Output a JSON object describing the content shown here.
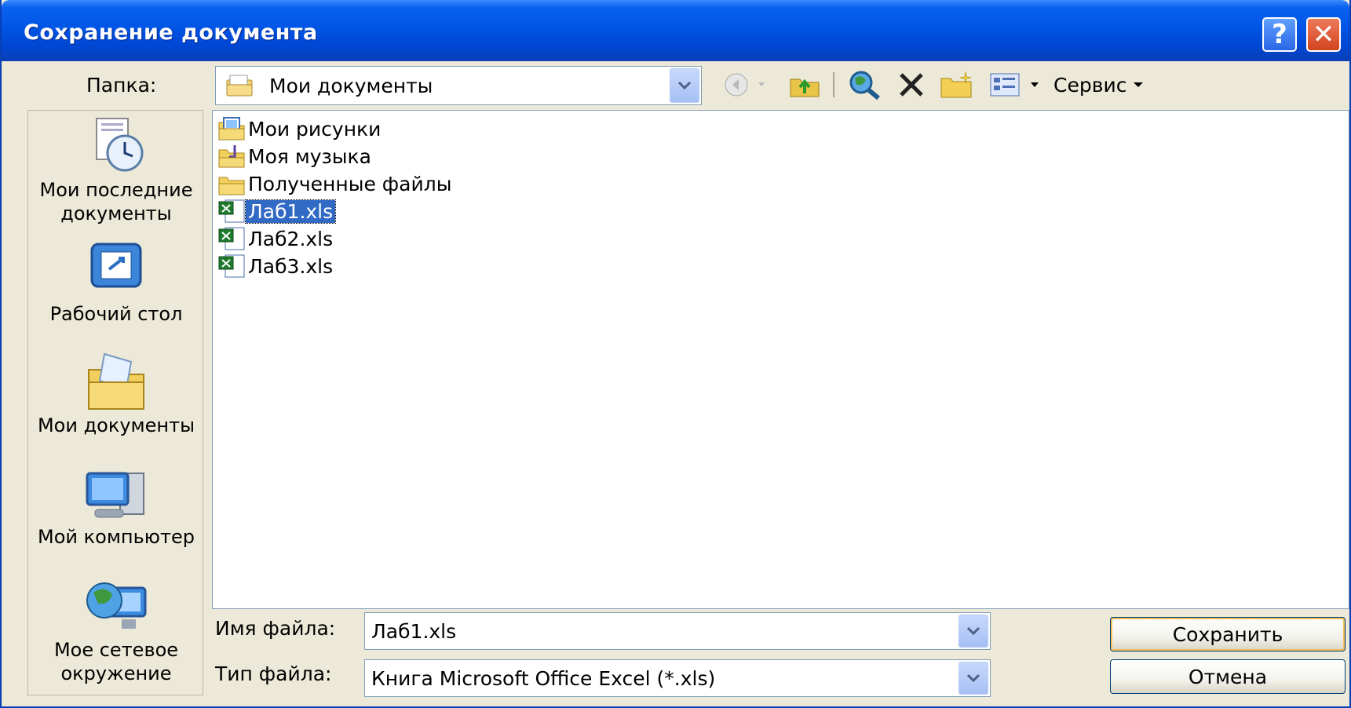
{
  "dialog": {
    "title": "Сохранение документа",
    "help_label": "?",
    "close_label": "✕"
  },
  "toolbar": {
    "folder_label": "Папка:",
    "folder_value": "Мои документы",
    "tools_label": "Сервис"
  },
  "places": [
    {
      "icon": "recent-documents-icon",
      "label": "Мои последние документы"
    },
    {
      "icon": "desktop-icon",
      "label": "Рабочий стол"
    },
    {
      "icon": "my-documents-icon",
      "label": "Мои документы"
    },
    {
      "icon": "my-computer-icon",
      "label": "Мой компьютер"
    },
    {
      "icon": "network-places-icon",
      "label": "Мое сетевое окружение"
    }
  ],
  "files": [
    {
      "type": "folder-pictures",
      "name": "Мои рисунки",
      "selected": false
    },
    {
      "type": "folder-music",
      "name": "Моя музыка",
      "selected": false
    },
    {
      "type": "folder",
      "name": "Полученные файлы",
      "selected": false
    },
    {
      "type": "xls",
      "name": "Лаб1.xls",
      "selected": true
    },
    {
      "type": "xls",
      "name": "Лаб2.xls",
      "selected": false
    },
    {
      "type": "xls",
      "name": "Лаб3.xls",
      "selected": false
    }
  ],
  "form": {
    "filename_label": "Имя файла:",
    "filename_value": "Лаб1.xls",
    "filetype_label": "Тип файла:",
    "filetype_value": "Книга Microsoft Office Excel (*.xls)"
  },
  "buttons": {
    "save": "Сохранить",
    "cancel": "Отмена"
  },
  "colors": {
    "title_bar": "#0055e5",
    "selection": "#316ac5",
    "dialog_bg": "#ece9d8"
  }
}
